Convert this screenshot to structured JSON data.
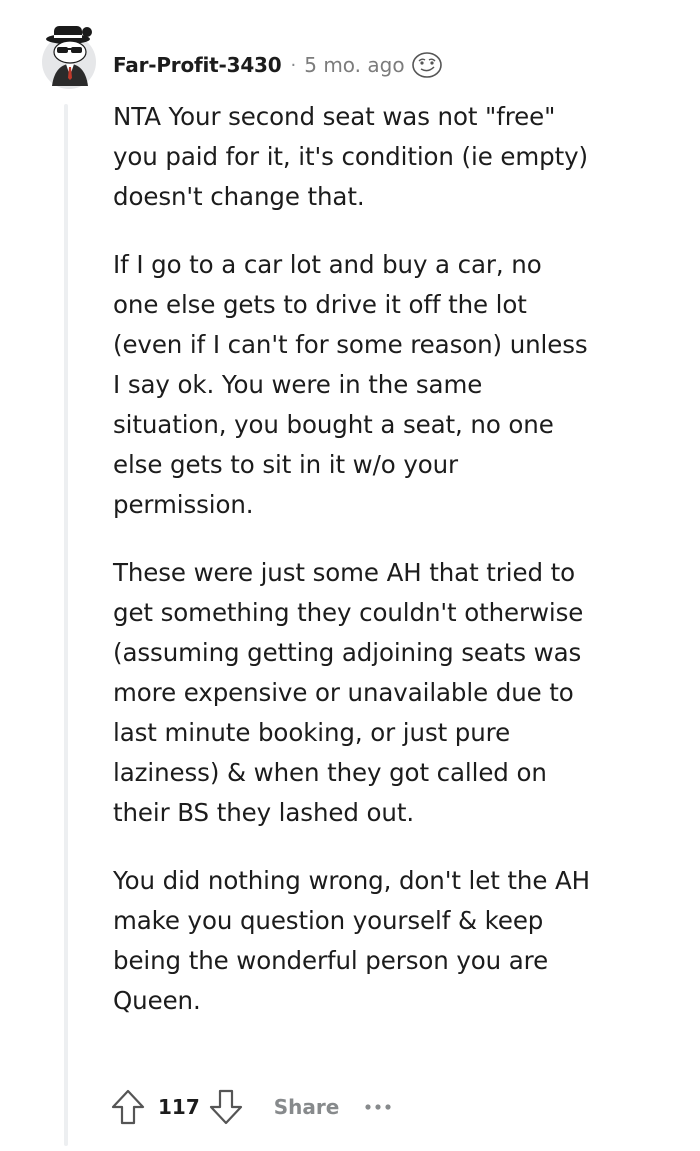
{
  "comment": {
    "author": "Far-Profit-3430",
    "separator": "·",
    "timestamp": "5 mo. ago",
    "flair_icon": "smirk-emoji-icon",
    "paragraphs": [
      "NTA Your second seat was not \"free\" you paid for it, it's condition (ie empty) doesn't change that.",
      "If I go to a car lot and buy a car, no one else gets to drive it off the lot (even if I can't for some reason) unless I say ok. You were in the same situation, you bought a seat, no one else gets to sit in it w/o your permission.",
      "These were just some AH that tried to get something they couldn't otherwise (assuming getting adjoining seats was more expensive or unavailable due to last minute booking, or just pure laziness) & when they got called on their BS they lashed out.",
      "You did nothing wrong, don't let the AH make you question yourself & keep being the wonderful person you are Queen."
    ]
  },
  "actions": {
    "score": "117",
    "share_label": "Share",
    "upvote_icon": "upvote-arrow-icon",
    "downvote_icon": "downvote-arrow-icon",
    "more_icon": "more-options-icon"
  },
  "colors": {
    "text": "#1c1c1c",
    "meta": "#7c7c7c",
    "muted": "#878a8c",
    "thread_line": "#edeff1"
  }
}
